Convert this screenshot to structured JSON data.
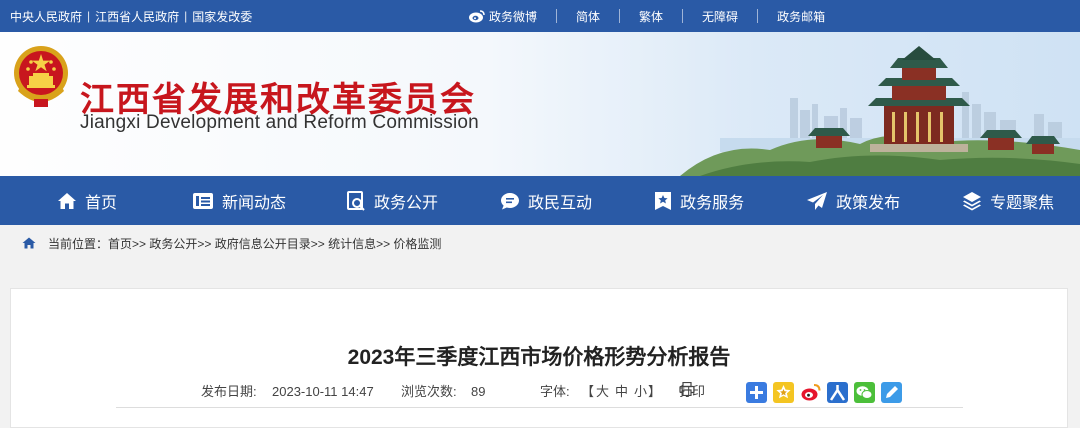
{
  "topbar": {
    "links": [
      "中央人民政府",
      "江西省人民政府",
      "国家发改委"
    ],
    "sep": "|",
    "right": [
      "政务微博",
      "简体",
      "繁体",
      "无障碍",
      "政务邮箱"
    ]
  },
  "header": {
    "title": "江西省发展和改革委员会",
    "subtitle": "Jiangxi Development and Reform Commission"
  },
  "nav": [
    "首页",
    "新闻动态",
    "政务公开",
    "政民互动",
    "政务服务",
    "政策发布",
    "专题聚焦"
  ],
  "breadcrumb": {
    "label": "当前位置：",
    "path": "首页>> 政务公开>> 政府信息公开目录>> 统计信息>> 价格监测"
  },
  "article": {
    "title": "2023年三季度江西市场价格形势分析报告",
    "date_label": "发布日期:",
    "date": "2023-10-11 14:47",
    "views_label": "浏览次数:",
    "views": "89",
    "font_label": "字体:",
    "font_open": "【",
    "font_big": "大",
    "font_mid": "中",
    "font_small": "小",
    "font_close": "】",
    "print": "打印"
  },
  "colors": {
    "primary": "#2a5aa6",
    "title_red": "#c7161d"
  }
}
